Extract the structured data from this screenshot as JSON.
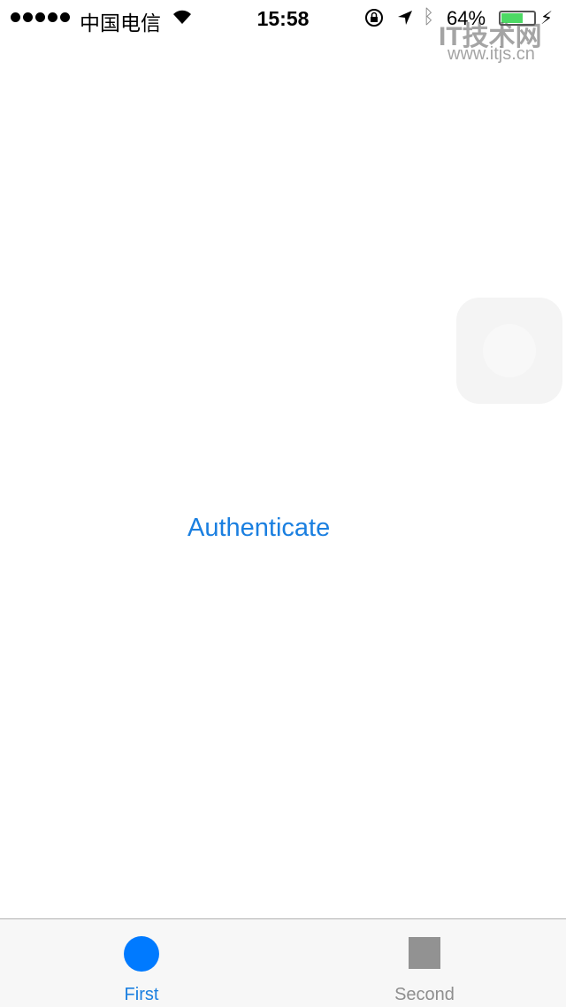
{
  "status_bar": {
    "carrier": "中国电信",
    "time": "15:58",
    "battery_percent_label": "64%",
    "battery_level": 0.64,
    "battery_color": "#4cd964",
    "signal_bars": 5
  },
  "watermark": {
    "logo": "IT技术网",
    "url": "www.itjs.cn"
  },
  "main": {
    "authenticate_label": "Authenticate",
    "accent": "#1a7fe0"
  },
  "tab_bar": {
    "tabs": [
      {
        "label": "First",
        "icon": "circle-icon",
        "color": "#007aff",
        "selected": true
      },
      {
        "label": "Second",
        "icon": "square-icon",
        "color": "#929292",
        "selected": false
      }
    ]
  }
}
